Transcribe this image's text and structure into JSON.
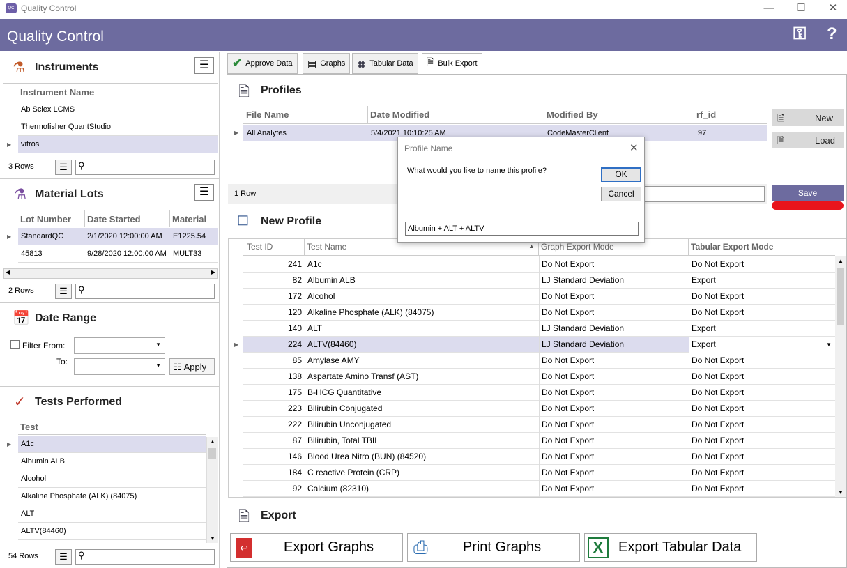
{
  "window": {
    "title": "Quality Control",
    "icon_text": "QC"
  },
  "header": {
    "title": "Quality Control"
  },
  "instruments": {
    "title": "Instruments",
    "column": "Instrument Name",
    "rows": [
      "Ab Sciex LCMS",
      "Thermofisher QuantStudio",
      "vitros"
    ],
    "count": "3 Rows"
  },
  "material_lots": {
    "title": "Material Lots",
    "columns": [
      "Lot Number",
      "Date Started",
      "Material"
    ],
    "rows": [
      [
        "StandardQC",
        "2/1/2020 12:00:00 AM",
        "E1225.54"
      ],
      [
        "45813",
        "9/28/2020 12:00:00 AM",
        "MULT33"
      ]
    ],
    "count": "2 Rows"
  },
  "date_range": {
    "title": "Date Range",
    "filter_from": "Filter From:",
    "to": "To:",
    "apply": "Apply"
  },
  "tests_performed": {
    "title": "Tests Performed",
    "column": "Test",
    "rows": [
      "A1c",
      "Albumin ALB",
      "Alcohol",
      "Alkaline Phosphate (ALK) (84075)",
      "ALT",
      "ALTV(84460)"
    ],
    "count": "54 Rows"
  },
  "tabs": [
    "Approve Data",
    "Graphs",
    "Tabular Data",
    "Bulk Export"
  ],
  "profiles": {
    "title": "Profiles",
    "columns": [
      "File Name",
      "Date Modified",
      "Modified By",
      "rf_id"
    ],
    "row": [
      "All Analytes",
      "5/4/2021 10:10:25 AM",
      "CodeMasterClient",
      "97"
    ],
    "count": "1 Row",
    "new": "New",
    "load": "Load",
    "save": "Save"
  },
  "dialog": {
    "title": "Profile Name",
    "prompt": "What would you like to name this profile?",
    "ok": "OK",
    "cancel": "Cancel",
    "value": "Albumin + ALT + ALTV"
  },
  "new_profile": {
    "title": "New Profile",
    "columns": [
      "Test ID",
      "Test Name",
      "Graph Export Mode",
      "Tabular Export Mode"
    ],
    "rows": [
      [
        "241",
        "A1c",
        "Do Not Export",
        "Do Not Export"
      ],
      [
        "82",
        "Albumin ALB",
        "LJ Standard Deviation",
        "Export"
      ],
      [
        "172",
        "Alcohol",
        "Do Not Export",
        "Do Not Export"
      ],
      [
        "120",
        "Alkaline Phosphate (ALK) (84075)",
        "Do Not Export",
        "Do Not Export"
      ],
      [
        "140",
        "ALT",
        "LJ Standard Deviation",
        "Export"
      ],
      [
        "224",
        "ALTV(84460)",
        "LJ Standard Deviation",
        "Export"
      ],
      [
        "85",
        "Amylase AMY",
        "Do Not Export",
        "Do Not Export"
      ],
      [
        "138",
        "Aspartate Amino Transf (AST)",
        "Do Not Export",
        "Do Not Export"
      ],
      [
        "175",
        "B-HCG Quantitative",
        "Do Not Export",
        "Do Not Export"
      ],
      [
        "223",
        "Bilirubin Conjugated",
        "Do Not Export",
        "Do Not Export"
      ],
      [
        "222",
        "Bilirubin Unconjugated",
        "Do Not Export",
        "Do Not Export"
      ],
      [
        "87",
        "Bilirubin, Total TBIL",
        "Do Not Export",
        "Do Not Export"
      ],
      [
        "146",
        "Blood Urea Nitro (BUN) (84520)",
        "Do Not Export",
        "Do Not Export"
      ],
      [
        "184",
        "C reactive Protein (CRP)",
        "Do Not Export",
        "Do Not Export"
      ],
      [
        "92",
        "Calcium (82310)",
        "Do Not Export",
        "Do Not Export"
      ]
    ]
  },
  "export": {
    "title": "Export",
    "export_graphs": "Export Graphs",
    "print_graphs": "Print Graphs",
    "export_tabular": "Export Tabular Data"
  },
  "colors": {
    "header": "#6d6b9f",
    "save": "#6d6b9f",
    "selection": "#dcdcee",
    "red_marker": "#e8141c"
  }
}
